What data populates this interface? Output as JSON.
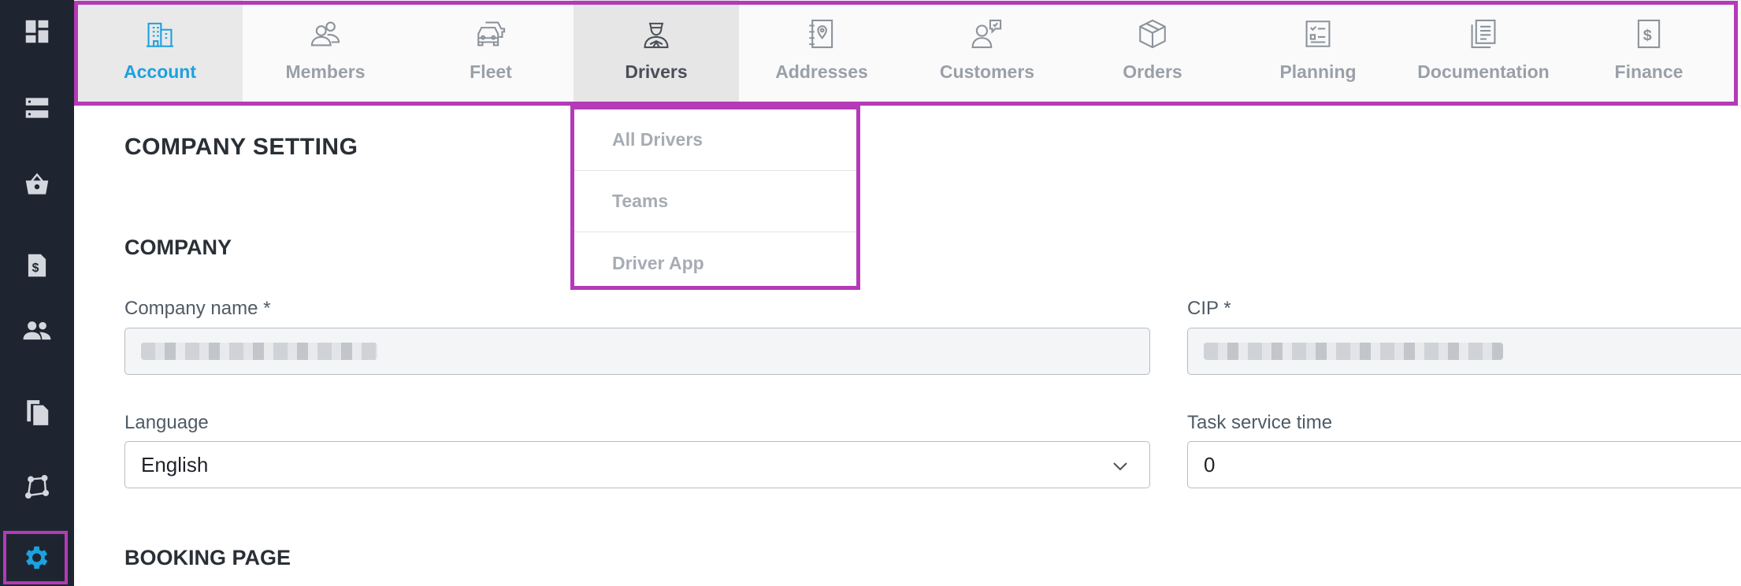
{
  "sidebar": {
    "items": [
      {
        "name": "dashboard-icon"
      },
      {
        "name": "storage-icon"
      },
      {
        "name": "basket-icon"
      },
      {
        "name": "invoice-icon"
      },
      {
        "name": "people-icon"
      },
      {
        "name": "documents-icon"
      },
      {
        "name": "route-icon"
      },
      {
        "name": "gear-icon",
        "active": true
      }
    ]
  },
  "topnav": {
    "tabs": [
      {
        "label": "Account",
        "icon": "building-icon"
      },
      {
        "label": "Members",
        "icon": "members-icon"
      },
      {
        "label": "Fleet",
        "icon": "car-icon"
      },
      {
        "label": "Drivers",
        "icon": "driver-icon"
      },
      {
        "label": "Addresses",
        "icon": "address-book-icon"
      },
      {
        "label": "Customers",
        "icon": "customer-icon"
      },
      {
        "label": "Orders",
        "icon": "box-icon"
      },
      {
        "label": "Planning",
        "icon": "checklist-icon"
      },
      {
        "label": "Documentation",
        "icon": "document-icon"
      },
      {
        "label": "Finance",
        "icon": "dollar-icon"
      }
    ],
    "active_tab": "Account",
    "open_tab": "Drivers"
  },
  "dropdown": {
    "items": [
      "All Drivers",
      "Teams",
      "Driver App"
    ]
  },
  "main": {
    "page_title": "COMPANY SETTING",
    "section_company": "COMPANY",
    "company_name_label": "Company name *",
    "cip_label": "CIP *",
    "language_label": "Language",
    "language_value": "English",
    "task_service_label": "Task service time",
    "task_service_value": "0",
    "section_booking": "BOOKING PAGE"
  },
  "colors": {
    "accent": "#1da1df",
    "highlight": "#b43ab7",
    "sidebar_bg": "#1e2530"
  }
}
